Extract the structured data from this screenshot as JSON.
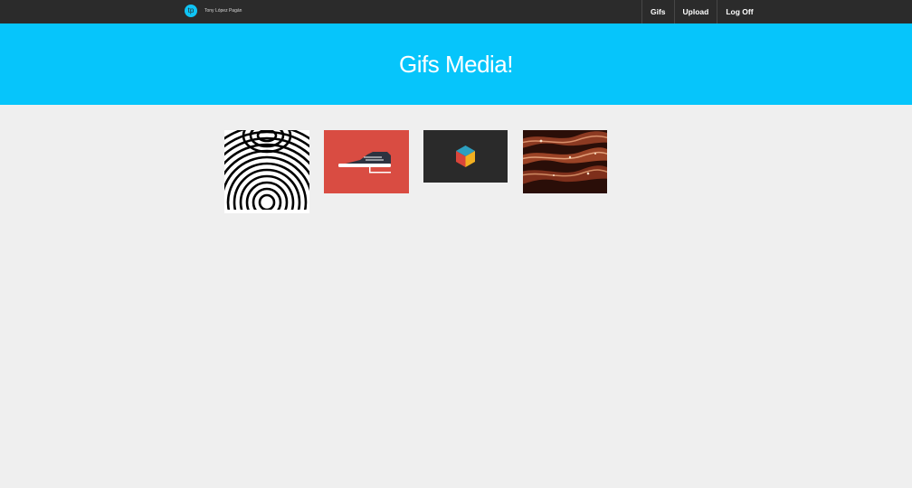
{
  "header": {
    "logo_text": "tp",
    "user_name": "Tony López Pagán",
    "nav": [
      {
        "label": "Gifs"
      },
      {
        "label": "Upload"
      },
      {
        "label": "Log Off"
      }
    ]
  },
  "hero": {
    "title": "Gifs Media!"
  },
  "gallery": {
    "items": [
      {
        "subject": "optical-illusion-rings"
      },
      {
        "subject": "sneaker-on-red"
      },
      {
        "subject": "color-cube-on-dark"
      },
      {
        "subject": "sizzling-bacon"
      }
    ]
  },
  "colors": {
    "topbar": "#2b2b2b",
    "accent": "#06c5fb",
    "page_background": "#efefef",
    "sneaker_background": "#d94c42"
  }
}
